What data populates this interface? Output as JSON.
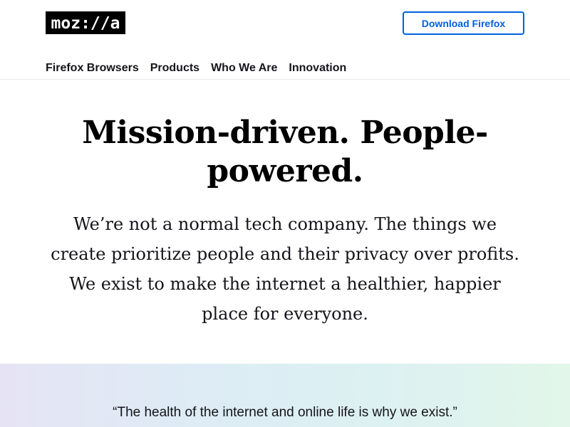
{
  "header": {
    "logo_text": "moz://a",
    "download_label": "Download Firefox"
  },
  "nav": {
    "items": [
      {
        "label": "Firefox Browsers"
      },
      {
        "label": "Products"
      },
      {
        "label": "Who We Are"
      },
      {
        "label": "Innovation"
      }
    ]
  },
  "hero": {
    "title": "Mission-driven. People-powered.",
    "subtitle": "We’re not a normal tech company. The things we create prioritize people and their privacy over profits. We exist to make the internet a healthier, happier place for everyone."
  },
  "quote": {
    "text": "“The health of the internet and online life is why we exist.”"
  },
  "colors": {
    "accent": "#0060df",
    "text": "#15141a",
    "logo_bg": "#000000"
  }
}
